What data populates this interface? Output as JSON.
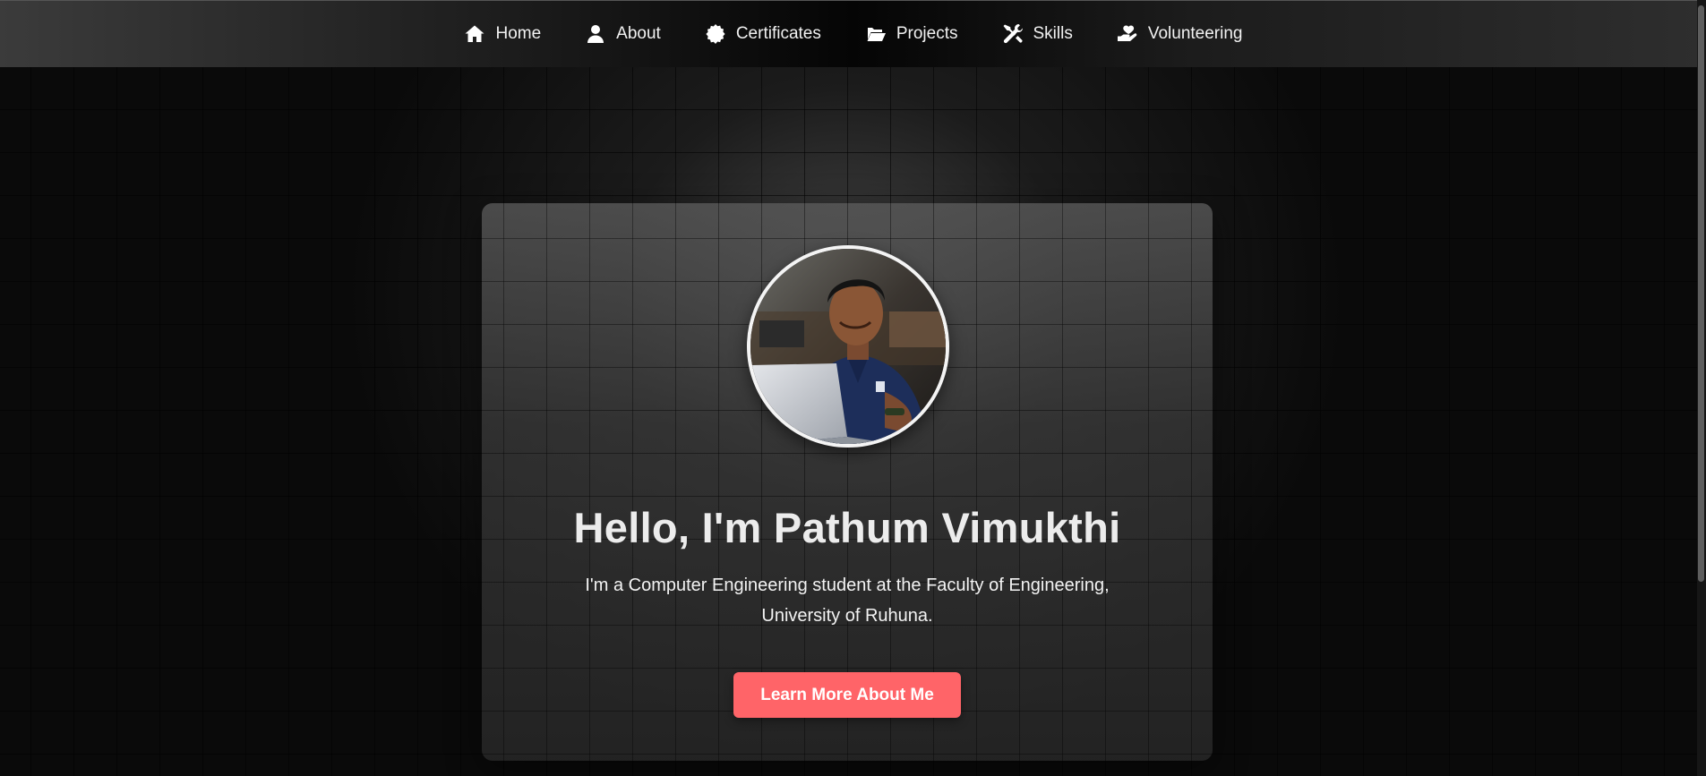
{
  "nav": {
    "items": [
      {
        "label": "Home",
        "icon": "home-icon"
      },
      {
        "label": "About",
        "icon": "user-icon"
      },
      {
        "label": "Certificates",
        "icon": "certificate-icon"
      },
      {
        "label": "Projects",
        "icon": "folder-open-icon"
      },
      {
        "label": "Skills",
        "icon": "tools-icon"
      },
      {
        "label": "Volunteering",
        "icon": "hand-holding-heart-icon"
      }
    ]
  },
  "hero": {
    "title": "Hello, I'm Pathum Vimukthi",
    "description": "I'm a Computer Engineering student at the Faculty of Engineering, University of Ruhuna.",
    "cta_label": "Learn More About Me"
  },
  "colors": {
    "accent": "#ff6468",
    "background": "#0a0a0a",
    "text": "#ececec"
  }
}
